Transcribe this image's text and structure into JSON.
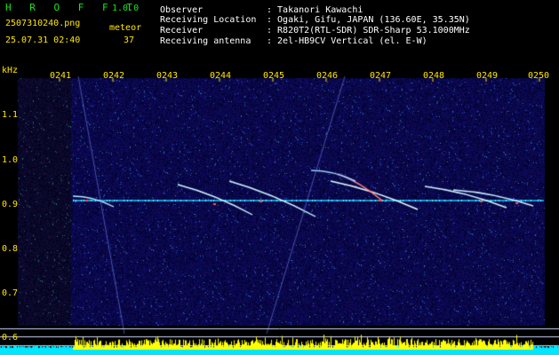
{
  "header": {
    "app_title": "H R O F F T",
    "app_version": "1.0.0",
    "filename": "2507310240.png",
    "datetime": "25.07.31 02:40",
    "meteor_label": "meteor",
    "meteor_count": "37",
    "info_labels": [
      "Observer",
      "Receiving Location",
      "Receiver",
      "Receiving antenna"
    ],
    "info_values": [
      ": Takanori Kawachi",
      ": Ogaki, Gifu, JAPAN (136.60E, 35.35N)",
      ": R820T2(RTL-SDR) SDR-Sharp 53.1000MHz",
      ": 2el-HB9CV Vertical (el. E-W)"
    ]
  },
  "chart_data": {
    "type": "heatmap",
    "ylabel": "kHz",
    "yticks": [
      "1.1",
      "1.0",
      "0.9",
      "0.8",
      "0.7",
      "0.6"
    ],
    "xticks": [
      "0241",
      "0242",
      "0243",
      "0244",
      "0245",
      "0246",
      "0247",
      "0248",
      "0249",
      "0250"
    ],
    "colors": {
      "background": "#0a0a3c",
      "carrier": "#19c8ff",
      "bottom_band_cyan": "#00ffff",
      "bottom_band_yellow": "#ffff00"
    }
  }
}
